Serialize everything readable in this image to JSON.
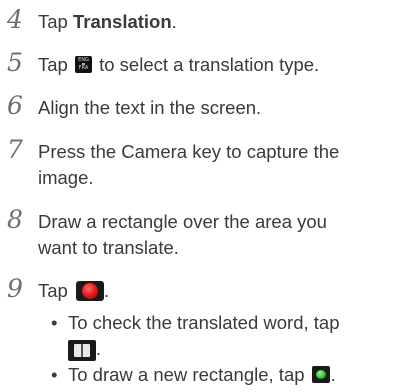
{
  "steps": [
    {
      "number": "4",
      "prefix": "Tap ",
      "bold": "Translation",
      "suffix": "."
    },
    {
      "number": "5",
      "prefix": "Tap ",
      "suffix": " to select a translation type.",
      "icon": "eng-fra-language-icon",
      "icon_lines": [
        "ENG",
        "FRA"
      ]
    },
    {
      "number": "6",
      "text": "Align the text in the screen."
    },
    {
      "number": "7",
      "line1": "Press the Camera key to capture the",
      "line2": "image."
    },
    {
      "number": "8",
      "line1": "Draw a rectangle over the area you",
      "line2": "want to translate."
    },
    {
      "number": "9",
      "prefix": "Tap ",
      "suffix": ".",
      "icon": "red-capture-icon"
    }
  ],
  "bullets": [
    {
      "marker": "•",
      "line1": "To check the translated word, tap",
      "line2_suffix": ".",
      "icon": "dictionary-book-icon"
    },
    {
      "marker": "•",
      "prefix": "To draw a new rectangle, tap ",
      "suffix": ".",
      "icon": "green-new-rectangle-icon"
    }
  ],
  "colors": {
    "text": "#3a3a3a",
    "step_number": "#6f6f6f",
    "capture_red": "#e01010",
    "new_rect_green": "#22c022"
  }
}
